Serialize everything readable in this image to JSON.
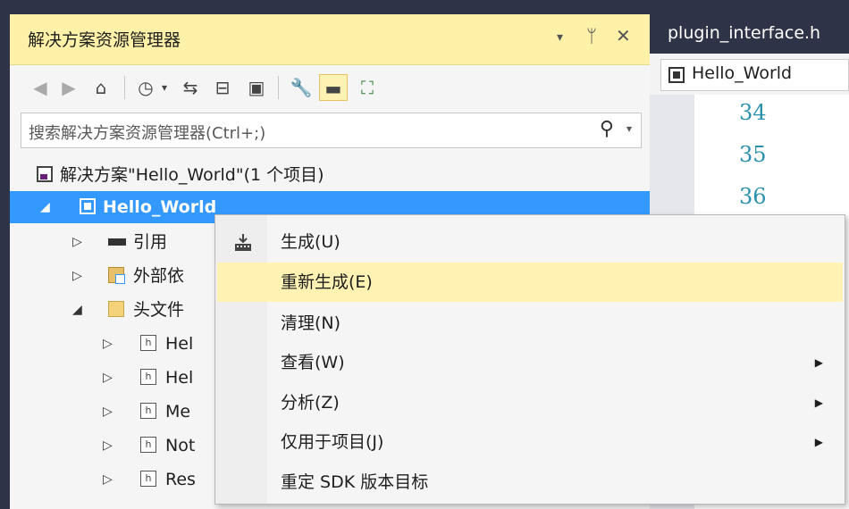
{
  "solution_explorer": {
    "title": "解决方案资源管理器",
    "title_buttons": {
      "dropdown": "▾",
      "pin": "ᛘ",
      "close": "✕"
    },
    "search_placeholder": "搜索解决方案资源管理器(Ctrl+;)",
    "tree": {
      "solution": "解决方案\"Hello_World\"(1 个项目)",
      "project": "Hello_World",
      "references": "引用",
      "external_deps": "外部依",
      "header_files": "头文件",
      "files": [
        "Hel",
        "Hel",
        "Me",
        "Not",
        "Res"
      ]
    }
  },
  "editor": {
    "tab_title": "plugin_interface.h",
    "nav_scope": "Hello_World",
    "line_numbers": [
      "34",
      "35",
      "36"
    ]
  },
  "context_menu": {
    "items": [
      {
        "label": "生成(U)",
        "has_icon": true,
        "submenu": false
      },
      {
        "label": "重新生成(E)",
        "highlighted": true,
        "submenu": false
      },
      {
        "label": "清理(N)",
        "submenu": false
      },
      {
        "label": "查看(W)",
        "submenu": true
      },
      {
        "label": "分析(Z)",
        "submenu": true
      },
      {
        "label": "仅用于项目(J)",
        "submenu": true
      },
      {
        "label": "重定 SDK 版本目标",
        "submenu": false
      }
    ]
  },
  "colors": {
    "title_bar": "#fff2a8",
    "selection": "#3399ff",
    "menu_highlight": "#fff2b3",
    "frame": "#2f3347"
  }
}
